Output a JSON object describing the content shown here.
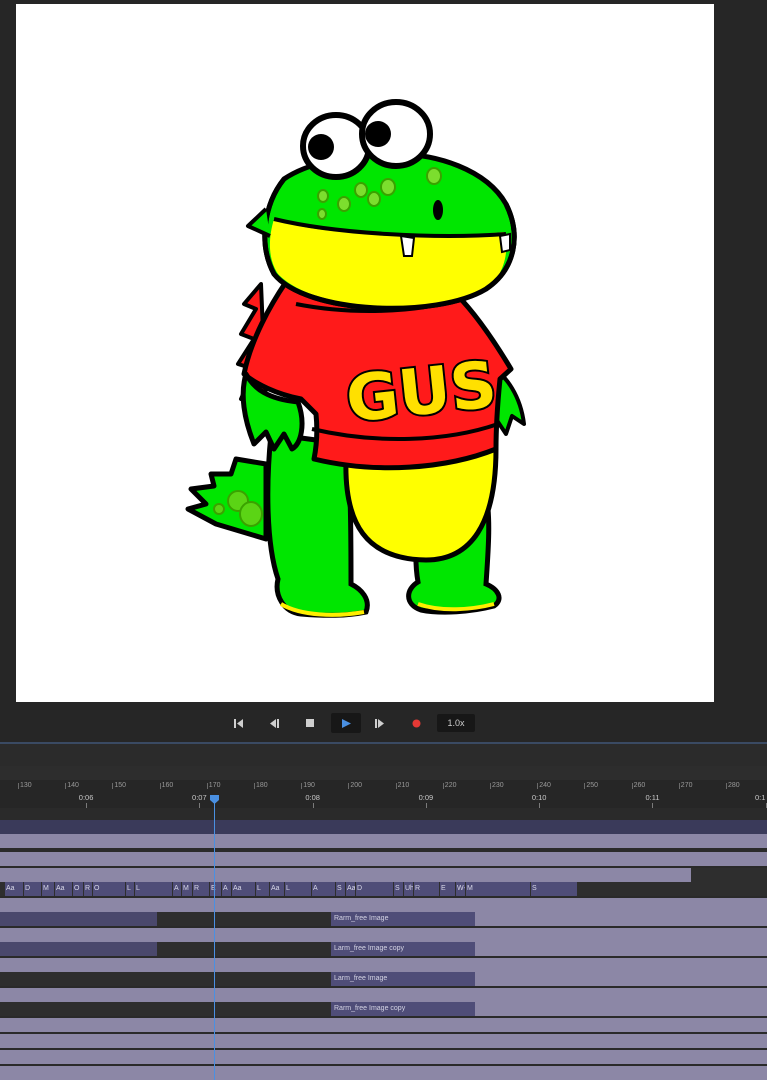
{
  "preview": {
    "shirt_text": "GUS"
  },
  "transport": {
    "buttons": [
      {
        "name": "skip-to-start-button",
        "icon": "skip-to-start-icon"
      },
      {
        "name": "step-back-button",
        "icon": "step-back-icon"
      },
      {
        "name": "stop-button",
        "icon": "stop-icon"
      },
      {
        "name": "play-button",
        "icon": "play-icon"
      },
      {
        "name": "step-forward-button",
        "icon": "step-forward-icon"
      },
      {
        "name": "record-button",
        "icon": "record-icon"
      }
    ],
    "speed": "1.0x",
    "accent": "#4a90e2",
    "record_color": "#e53935"
  },
  "timeline": {
    "frame_labels": [
      "130",
      "140",
      "150",
      "160",
      "170",
      "180",
      "190",
      "200",
      "210",
      "220",
      "230",
      "240",
      "250",
      "260",
      "270",
      "280"
    ],
    "time_labels": [
      "0:06",
      "0:07",
      "0:08",
      "0:09",
      "0:10",
      "0:11",
      "0:1"
    ],
    "playhead_frame": 171,
    "visemes": [
      "Aa",
      "D",
      "M",
      "Aa",
      "O",
      "R",
      "O",
      "L",
      "L",
      "A",
      "M",
      "R",
      "E",
      "A",
      "Aa",
      "L",
      "Aa",
      "L",
      "A",
      "S",
      "Aa",
      "D",
      "S",
      "Uh",
      "R",
      "E",
      "W-Oo",
      "M",
      "S"
    ],
    "clips": {
      "rarm_free_image": "Rarm_free Image",
      "larm_free_image_copy": "Larm_free Image copy",
      "larm_free_image": "Larm_free Image",
      "rarm_free_image_copy": "Rarm_free Image copy"
    }
  }
}
